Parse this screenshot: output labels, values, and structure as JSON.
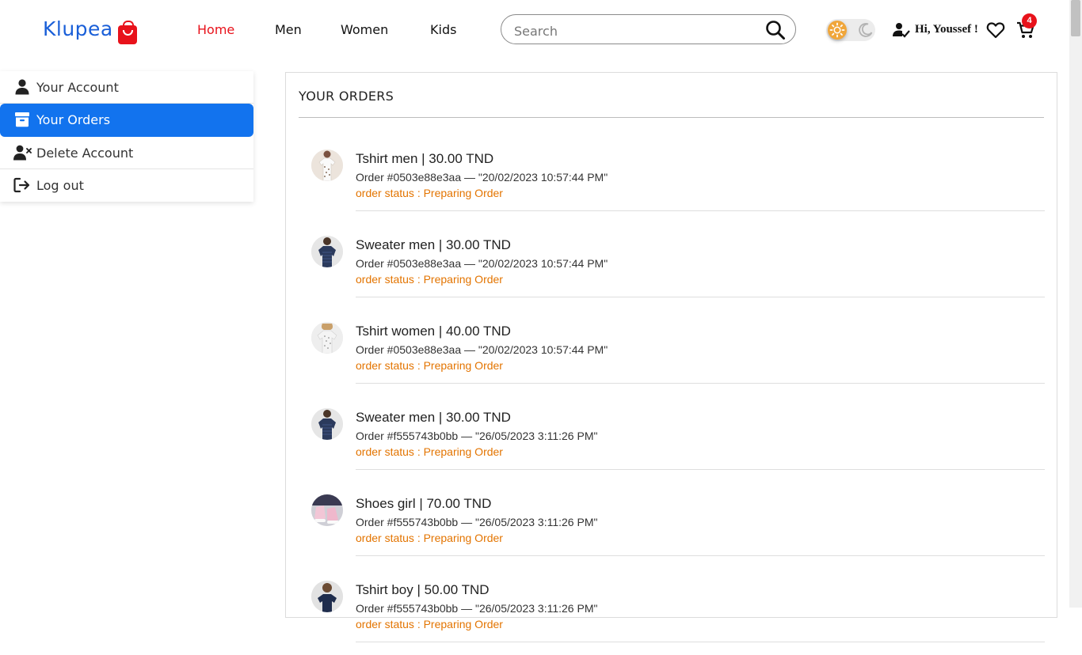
{
  "header": {
    "logo_text": "Klupea",
    "nav": [
      {
        "label": "Home",
        "active": true
      },
      {
        "label": "Men",
        "active": false
      },
      {
        "label": "Women",
        "active": false
      },
      {
        "label": "Kids",
        "active": false
      }
    ],
    "search_placeholder": "Search",
    "greeting": "Hi, Youssef !",
    "cart_count": "4",
    "accent_color": "#e8121b",
    "brand_color": "#1a5fd8"
  },
  "sidebar": {
    "items": [
      {
        "label": "Your Account",
        "icon": "user-icon",
        "active": false
      },
      {
        "label": "Your Orders",
        "icon": "archive-box-icon",
        "active": true
      },
      {
        "label": "Delete Account",
        "icon": "user-remove-icon",
        "active": false
      },
      {
        "label": "Log out",
        "icon": "logout-icon",
        "active": false
      }
    ],
    "active_color": "#1273ee"
  },
  "orders": {
    "title": "YOUR ORDERS",
    "status_color": "#e37400",
    "items": [
      {
        "name": "Tshirt men | 30.00 TND",
        "order": "Order #0503e88e3aa — \"20/02/2023 10:57:44 PM\"",
        "status": "order status : Preparing Order",
        "thumb": "white-tshirt-photo"
      },
      {
        "name": "Sweater men | 30.00 TND",
        "order": "Order #0503e88e3aa — \"20/02/2023 10:57:44 PM\"",
        "status": "order status : Preparing Order",
        "thumb": "navy-sweater-photo"
      },
      {
        "name": "Tshirt women | 40.00 TND",
        "order": "Order #0503e88e3aa — \"20/02/2023 10:57:44 PM\"",
        "status": "order status : Preparing Order",
        "thumb": "grey-tshirt-photo"
      },
      {
        "name": "Sweater men | 30.00 TND",
        "order": "Order #f555743b0bb — \"26/05/2023 3:11:26 PM\"",
        "status": "order status : Preparing Order",
        "thumb": "navy-sweater-photo"
      },
      {
        "name": "Shoes girl | 70.00 TND",
        "order": "Order #f555743b0bb — \"26/05/2023 3:11:26 PM\"",
        "status": "order status : Preparing Order",
        "thumb": "pink-shoes-photo"
      },
      {
        "name": "Tshirt boy | 50.00 TND",
        "order": "Order #f555743b0bb — \"26/05/2023 3:11:26 PM\"",
        "status": "order status : Preparing Order",
        "thumb": "boy-tshirt-photo"
      }
    ]
  }
}
